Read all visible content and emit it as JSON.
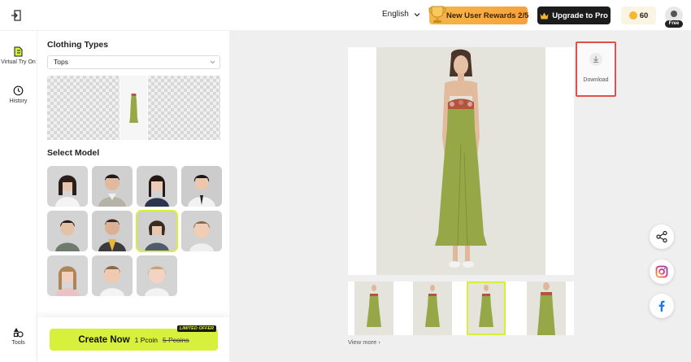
{
  "header": {
    "language": "English",
    "rewards_label": "New User Rewards 2/5",
    "upgrade_label": "Upgrade to Pro",
    "coins": "60",
    "plan_badge": "Free"
  },
  "leftnav": {
    "items": [
      {
        "label": "Virtual Try On",
        "icon": "hanger-icon"
      },
      {
        "label": "History",
        "icon": "clock-icon"
      },
      {
        "label": "Tools",
        "icon": "shapes-icon"
      }
    ]
  },
  "panel": {
    "clothing_title": "Clothing Types",
    "clothing_selected": "Tops",
    "select_model_title": "Select Model",
    "model_count": 11,
    "selected_model_index": 6
  },
  "create": {
    "label": "Create Now",
    "price": "1 Pcoin",
    "old_price": "5 Pcoins",
    "offer_tag": "LIMITED OFFER"
  },
  "preview": {
    "download_label": "Download",
    "view_more_label": "View more ›",
    "selected_thumb_index": 2
  },
  "colors": {
    "accent": "#d7f03b",
    "highlight_border": "#e0504c",
    "rewards": "#f4b64a"
  }
}
